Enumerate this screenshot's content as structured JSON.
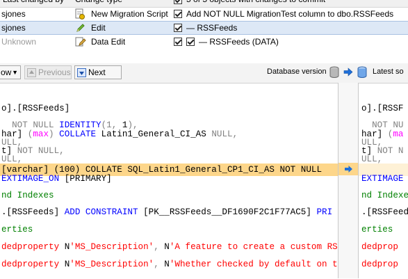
{
  "window": {
    "headers": {
      "last_changed_by": "Last changed by",
      "change_type": "Change type",
      "objects_with_changes": "5 of 5 objects with changes to commit"
    },
    "rows": [
      {
        "user": "sjones",
        "change": "New Migration Script",
        "summary": "Add NOT NULL MigrationTest column to dbo.RSSFeeds",
        "checked": true
      },
      {
        "user": "sjones",
        "change": "Edit",
        "summary": "— RSSFeeds",
        "checked": true
      },
      {
        "user": "Unknown",
        "change": "Data Edit",
        "summary": "— RSSFeeds (DATA)",
        "checked": true
      }
    ]
  },
  "toolbar": {
    "partial_button": "ow",
    "previous_label": "Previous",
    "next_label": "Next",
    "database_version_label": "Database version",
    "latest_source_label": "Latest so"
  },
  "left_code": [
    "o].[RSSFeeds]",
    "",
    "  NOT NULL IDENTITY(1, 1),",
    "har] (max) COLLATE Latin1_General_CI_AS NULL,",
    "ULL,",
    "t] NOT NULL,",
    "ULL,",
    "[varchar] (100) COLLATE SQL_Latin1_General_CP1_CI_AS NOT NULL",
    "EXTIMAGE_ON [PRIMARY]",
    "",
    "nd Indexes",
    "",
    ".[RSSFeeds] ADD CONSTRAINT [PK__RSSFeeds__DF1690F2C1F77AC5] PRI",
    "",
    "erties",
    "",
    "dedproperty N'MS_Description', N'A feature to create a custom RS",
    "",
    "dedproperty N'MS_Description', N'Whether checked by default on t"
  ],
  "right_code": [
    "o].[RSSF",
    "",
    "  NOT NU",
    "har] (ma",
    "ULL,",
    "t] NOT N",
    "ULL,",
    "",
    "EXTIMAGE",
    "",
    "nd Indexe",
    "",
    ".[RSSFeed",
    "",
    "erties",
    "",
    "dedprop",
    "",
    "dedprop"
  ],
  "colors": {
    "highlight": "#fdd68a",
    "keyword": "#0000ff",
    "comment": "#008000",
    "string": "#ff0000",
    "function": "#ff00ff",
    "gray": "#808080",
    "arrow": "#1e6fd9"
  }
}
